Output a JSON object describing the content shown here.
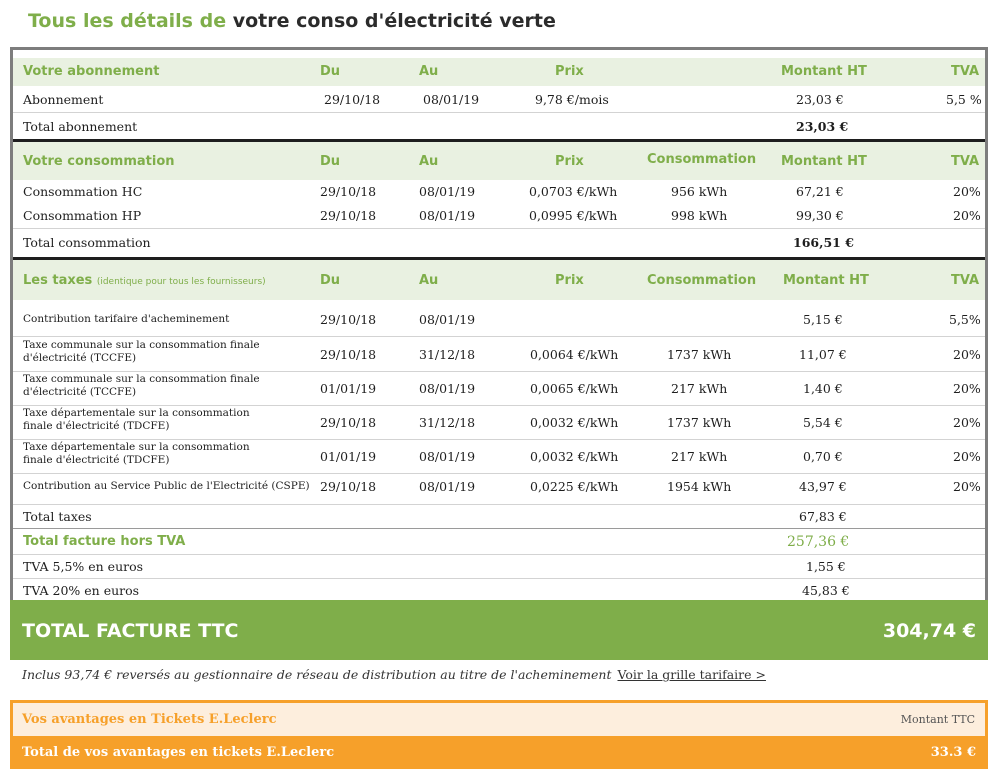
{
  "page_title": {
    "part1": "Tous les détails de",
    "part2": "votre conso d'électricité verte"
  },
  "columns": {
    "du": "Du",
    "au": "Au",
    "prix": "Prix",
    "consommation": "Consommation",
    "montant": "Montant HT",
    "tva": "TVA"
  },
  "abonnement": {
    "title": "Votre abonnement",
    "rows": [
      {
        "label": "Abonnement",
        "du": "29/10/18",
        "au": "08/01/19",
        "prix": "9,78 €/mois",
        "montant": "23,03 €",
        "tva": "5,5 %"
      }
    ],
    "total_label": "Total abonnement",
    "total_value": "23,03 €"
  },
  "consommation": {
    "title": "Votre consommation",
    "rows": [
      {
        "label": "Consommation HC",
        "du": "29/10/18",
        "au": "08/01/19",
        "prix": "0,0703 €/kWh",
        "conso": "956 kWh",
        "montant": "67,21 €",
        "tva": "20%"
      },
      {
        "label": "Consommation HP",
        "du": "29/10/18",
        "au": "08/01/19",
        "prix": "0,0995 €/kWh",
        "conso": "998 kWh",
        "montant": "99,30 €",
        "tva": "20%"
      }
    ],
    "total_label": "Total consommation",
    "total_value": "166,51 €"
  },
  "taxes": {
    "title": "Les taxes",
    "note": "(identique pour tous les fournisseurs)",
    "rows": [
      {
        "label": "Contribution tarifaire d'acheminement",
        "du": "29/10/18",
        "au": "08/01/19",
        "prix": "",
        "conso": "",
        "montant": "5,15 €",
        "tva": "5,5%"
      },
      {
        "label": "Taxe communale sur la consommation finale d'électricité (TCCFE)",
        "du": "29/10/18",
        "au": "31/12/18",
        "prix": "0,0064 €/kWh",
        "conso": "1737 kWh",
        "montant": "11,07 €",
        "tva": "20%"
      },
      {
        "label": "Taxe communale sur la consommation finale d'électricité (TCCFE)",
        "du": "01/01/19",
        "au": "08/01/19",
        "prix": "0,0065 €/kWh",
        "conso": "217 kWh",
        "montant": "1,40 €",
        "tva": "20%"
      },
      {
        "label": "Taxe départementale sur la consommation finale d'électricité (TDCFE)",
        "du": "29/10/18",
        "au": "31/12/18",
        "prix": "0,0032 €/kWh",
        "conso": "1737 kWh",
        "montant": "5,54 €",
        "tva": "20%"
      },
      {
        "label": "Taxe départementale sur la consommation finale d'électricité (TDCFE)",
        "du": "01/01/19",
        "au": "08/01/19",
        "prix": "0,0032 €/kWh",
        "conso": "217 kWh",
        "montant": "0,70 €",
        "tva": "20%"
      },
      {
        "label": "Contribution au Service Public de l'Electricité (CSPE)",
        "du": "29/10/18",
        "au": "08/01/19",
        "prix": "0,0225 €/kWh",
        "conso": "1954 kWh",
        "montant": "43,97 €",
        "tva": "20%"
      }
    ],
    "total_label": "Total taxes",
    "total_value": "67,83 €"
  },
  "summary": {
    "hors_tva_label": "Total facture hors TVA",
    "hors_tva_value": "257,36 €",
    "tva55_label": "TVA 5,5% en euros",
    "tva55_value": "1,55 €",
    "tva20_label": "TVA 20% en euros",
    "tva20_value": "45,83 €"
  },
  "ttc": {
    "label": "TOTAL FACTURE TTC",
    "value": "304,74 €"
  },
  "inclus": {
    "text": "Inclus 93,74 € reversés au gestionnaire de réseau de distribution au titre de l'acheminement",
    "link": "Voir la grille tarifaire >"
  },
  "tickets": {
    "title": "Vos avantages en Tickets E.Leclerc",
    "col": "Montant TTC",
    "total_label": "Total de vos avantages en tickets E.Leclerc",
    "total_value": "33.3 €"
  },
  "colors": {
    "green": "#7fae4a",
    "light_green": "#e9f1e1",
    "orange": "#f6a02a",
    "light_orange": "#fdeedd"
  }
}
